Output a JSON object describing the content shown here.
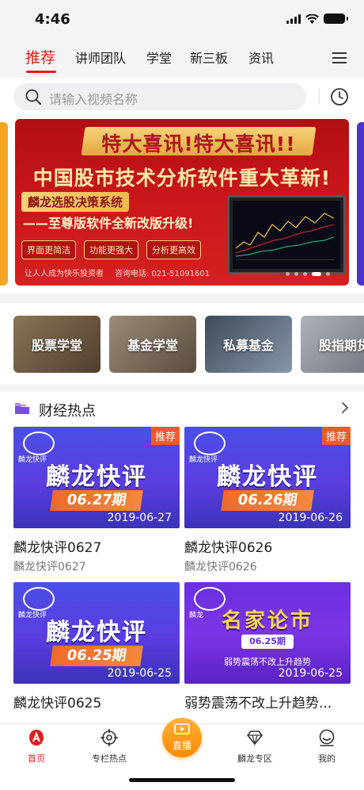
{
  "status": {
    "time": "4:46"
  },
  "nav": {
    "tabs": [
      {
        "label": "推荐",
        "active": true
      },
      {
        "label": "讲师团队"
      },
      {
        "label": "学堂"
      },
      {
        "label": "新三板"
      },
      {
        "label": "资讯"
      }
    ],
    "icons": {
      "menu": "hamburger-menu-icon"
    }
  },
  "search": {
    "placeholder": "请输入视频名称",
    "icons": [
      "search-icon",
      "history-clock-icon"
    ]
  },
  "banner": {
    "headline": "特大喜讯!特大喜讯!!",
    "title": "中国股市技术分析软件重大革新!",
    "subtitle": "麟龙选股决策系统",
    "subtitle2": "——至尊版软件全新改版升级!",
    "tags": [
      "界面更简洁",
      "功能更强大",
      "分析更高效"
    ],
    "footer": "让人人成为快乐投资者",
    "phone": "咨询电话: 021-51091601",
    "slide_count": 5,
    "active_slide": 4
  },
  "categories": [
    {
      "label": "股票学堂",
      "color": "#6b5a47"
    },
    {
      "label": "基金学堂",
      "color": "#7a6a5c"
    },
    {
      "label": "私募基金",
      "color": "#5b6a7a"
    },
    {
      "label": "股指期货",
      "color": "#8a8f96"
    }
  ],
  "hot": {
    "title": "财经热点",
    "icon": "folder-icon",
    "videos": [
      {
        "thumb_title": "麟龙快评",
        "issue": "06.27期",
        "date": "2019-06-27",
        "badge": "推荐",
        "logo": "麟龙快评",
        "title": "麟龙快评0627",
        "subtitle": "麟龙快评0627"
      },
      {
        "thumb_title": "麟龙快评",
        "issue": "06.26期",
        "date": "2019-06-26",
        "badge": "推荐",
        "logo": "麟龙快评",
        "title": "麟龙快评0626",
        "subtitle": "麟龙快评0626"
      },
      {
        "thumb_title": "麟龙快评",
        "issue": "06.25期",
        "date": "2019-06-25",
        "logo": "麟龙快评",
        "title": "麟龙快评0625",
        "subtitle": ""
      },
      {
        "thumb_title": "名家论市",
        "issue": "06.25期",
        "desc": "弱势震荡不改上升趋势",
        "date": "2019-06-25",
        "logo": "麟龙",
        "title": "弱势震荡不改上升趋势...",
        "subtitle": ""
      }
    ]
  },
  "tabbar": {
    "items": [
      {
        "label": "首页",
        "icon": "home-icon",
        "active": true
      },
      {
        "label": "专栏热点",
        "icon": "target-icon"
      },
      {
        "label": "直播",
        "icon": "live-tv-icon"
      },
      {
        "label": "麟龙专区",
        "icon": "diamond-icon"
      },
      {
        "label": "我的",
        "icon": "user-icon"
      }
    ]
  },
  "colors": {
    "accent": "#e02020",
    "live": "#ff8a00"
  }
}
